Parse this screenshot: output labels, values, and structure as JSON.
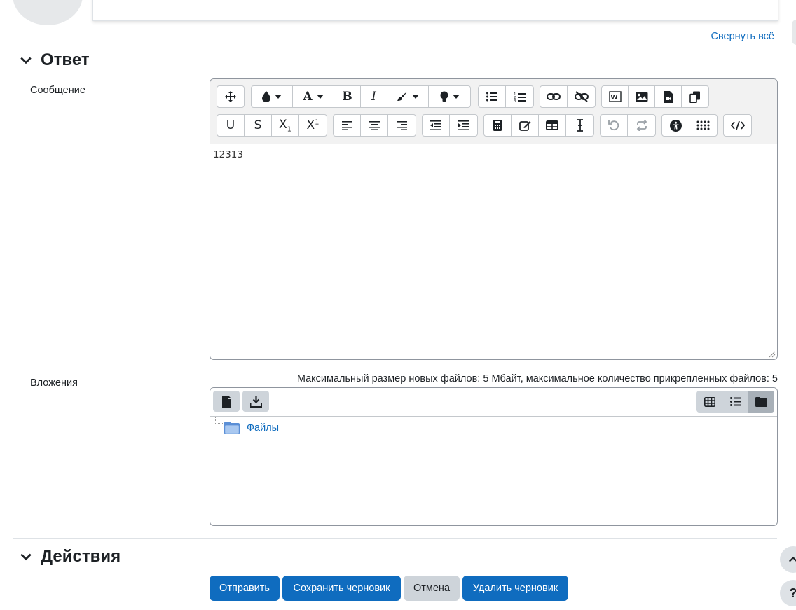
{
  "top": {
    "collapse_all": "Свернуть всё"
  },
  "answer_section": {
    "title": "Ответ",
    "message_label": "Сообщение",
    "editor_content": "12313"
  },
  "attachments": {
    "label": "Вложения",
    "limits": "Максимальный размер новых файлов: 5 Мбайт, максимальное количество прикрепленных файлов: 5",
    "folder_name": "Файлы"
  },
  "actions_section": {
    "title": "Действия",
    "submit": "Отправить",
    "save_draft": "Сохранить черновик",
    "cancel": "Отмена",
    "delete_draft": "Удалить черновик"
  },
  "help_icon": "?",
  "colors": {
    "primary": "#0f6cbf",
    "secondary": "#ced4da",
    "border": "#8f959e"
  }
}
